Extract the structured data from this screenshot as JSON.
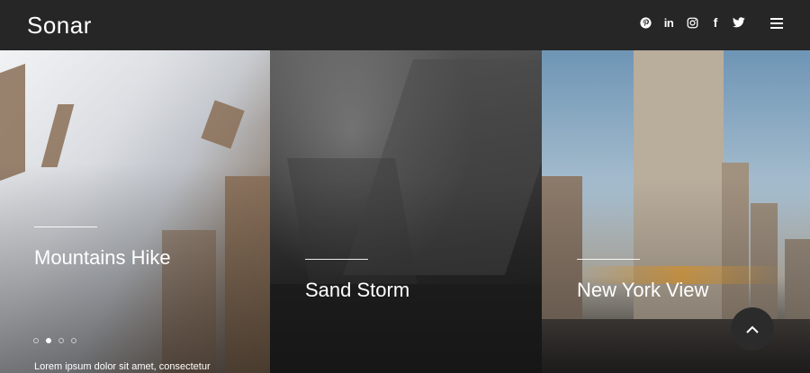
{
  "header": {
    "brand": "Sonar",
    "social": [
      {
        "name": "pinterest-icon"
      },
      {
        "name": "linkedin-icon",
        "glyph": "in"
      },
      {
        "name": "instagram-icon"
      },
      {
        "name": "facebook-icon",
        "glyph": "f"
      },
      {
        "name": "twitter-icon"
      }
    ],
    "menu_icon": "hamburger-menu-icon"
  },
  "panels": [
    {
      "title": "Mountains Hike",
      "excerpt": "Lorem ipsum dolor sit amet, consectetur",
      "dots": {
        "count": 4,
        "active_index": 1
      }
    },
    {
      "title": "Sand Storm"
    },
    {
      "title": "New York View"
    }
  ],
  "scroll_top_icon": "chevron-up-icon"
}
